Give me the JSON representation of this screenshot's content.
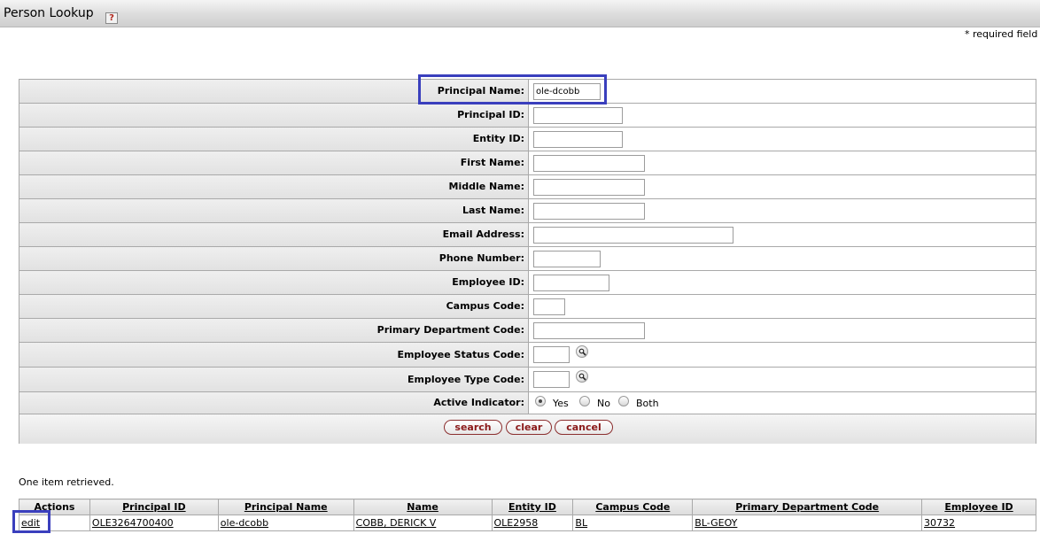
{
  "header": {
    "title": "Person Lookup",
    "help_icon": "?"
  },
  "required_note": "* required field",
  "form": {
    "fields": [
      {
        "label": "Principal Name:",
        "value": "ole-dcobb"
      },
      {
        "label": "Principal ID:",
        "value": ""
      },
      {
        "label": "Entity ID:",
        "value": ""
      },
      {
        "label": "First Name:",
        "value": ""
      },
      {
        "label": "Middle Name:",
        "value": ""
      },
      {
        "label": "Last Name:",
        "value": ""
      },
      {
        "label": "Email Address:",
        "value": ""
      },
      {
        "label": "Phone Number:",
        "value": ""
      },
      {
        "label": "Employee ID:",
        "value": ""
      },
      {
        "label": "Campus Code:",
        "value": ""
      },
      {
        "label": "Primary Department Code:",
        "value": ""
      },
      {
        "label": "Employee Status Code:",
        "value": "",
        "icon": "search-icon"
      },
      {
        "label": "Employee Type Code:",
        "value": "",
        "icon": "search-icon"
      }
    ],
    "active_indicator": {
      "label": "Active Indicator:",
      "options": [
        "Yes",
        "No",
        "Both"
      ],
      "selected": "Yes"
    },
    "buttons": {
      "search": "search",
      "clear": "clear",
      "cancel": "cancel"
    }
  },
  "results": {
    "count_text": "One item retrieved.",
    "columns": [
      "Actions",
      "Principal ID",
      "Principal Name",
      "Name",
      "Entity ID",
      "Campus Code",
      "Primary Department Code",
      "Employee ID"
    ],
    "rows": [
      {
        "action": "edit",
        "principal_id": "OLE3264700400",
        "principal_name": "ole-dcobb",
        "name": "COBB, DERICK V",
        "entity_id": "OLE2958",
        "campus_code": "BL",
        "primary_department_code": "BL-GEOY",
        "employee_id": "30732"
      }
    ]
  },
  "colors": {
    "highlight": "#3a3fbd",
    "button_text": "#8b1a1a"
  }
}
